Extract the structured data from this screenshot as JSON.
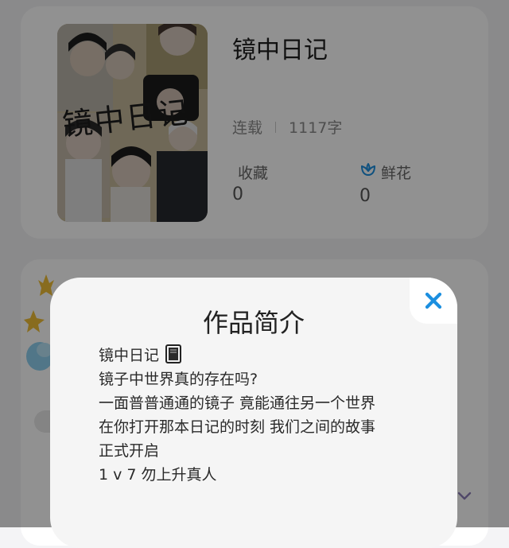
{
  "book": {
    "title": "镜中日记",
    "cover_title": "镜中日记",
    "status": "连载",
    "word_count": "1117字"
  },
  "stats": {
    "favorites_label": "收藏",
    "favorites_value": "0",
    "flowers_label": "鲜花",
    "flowers_value": "0"
  },
  "modal": {
    "title": "作品简介",
    "intro_lines": [
      "镜中日记",
      "镜子中世界真的存在吗?",
      "一面普普通通的镜子 竟能通往另一个世界",
      "在你打开那本日记的时刻 我们之间的故事",
      "正式开启",
      "1 v 7 勿上升真人"
    ]
  },
  "colors": {
    "accent": "#1b8fe0",
    "overlay": "rgba(0,0,0,0.43)"
  },
  "icons": {
    "close": "close-icon",
    "flower": "flower-icon",
    "book": "book-icon",
    "chevron": "chevron-down-icon"
  }
}
